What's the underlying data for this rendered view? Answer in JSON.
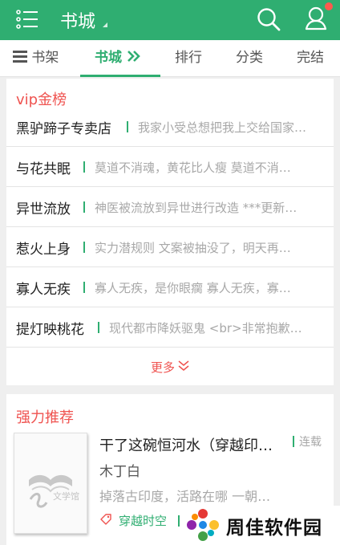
{
  "header": {
    "title": "书城"
  },
  "tabs": [
    {
      "label": "书架"
    },
    {
      "label": "书城"
    },
    {
      "label": "排行"
    },
    {
      "label": "分类"
    },
    {
      "label": "完结"
    }
  ],
  "vip": {
    "title": "vip金榜",
    "items": [
      {
        "name": "黑驴蹄子专卖店",
        "desc": "我家小受总想把我上交给国家…"
      },
      {
        "name": "与花共眠",
        "desc": "莫道不消魂，黄花比人瘦 莫道不消…"
      },
      {
        "name": "异世流放",
        "desc": "神医被流放到异世进行改造 ***更新…"
      },
      {
        "name": "惹火上身",
        "desc": "实力潜规则 文案被抽没了，明天再…"
      },
      {
        "name": "寡人无疾",
        "desc": "寡人无疾，是你眼瘸 寡人无疾，寡…"
      },
      {
        "name": "提灯映桃花",
        "desc": "现代都市降妖驱鬼 <br>非常抱歉…"
      }
    ],
    "more_label": "更多"
  },
  "recommend": {
    "title": "强力推荐",
    "book": {
      "title": "干了这碗恒河水（穿越印…",
      "status": "连载",
      "author": "木丁白",
      "intro": "掉落古印度，活路在哪 一朝…",
      "tag": "穿越时空",
      "cover_text": "文学馆"
    }
  },
  "watermark": {
    "text": "周佳软件园"
  },
  "colors": {
    "brand": "#2fae71",
    "accent": "#ef5350",
    "badge": "#ff5a4e"
  },
  "icons": [
    "list-menu-icon",
    "search-icon",
    "user-icon",
    "notification-dot",
    "bookshelf-icon",
    "double-chevron-right-icon",
    "double-chevron-down-icon",
    "tag-icon",
    "pinwheel-logo-icon"
  ]
}
